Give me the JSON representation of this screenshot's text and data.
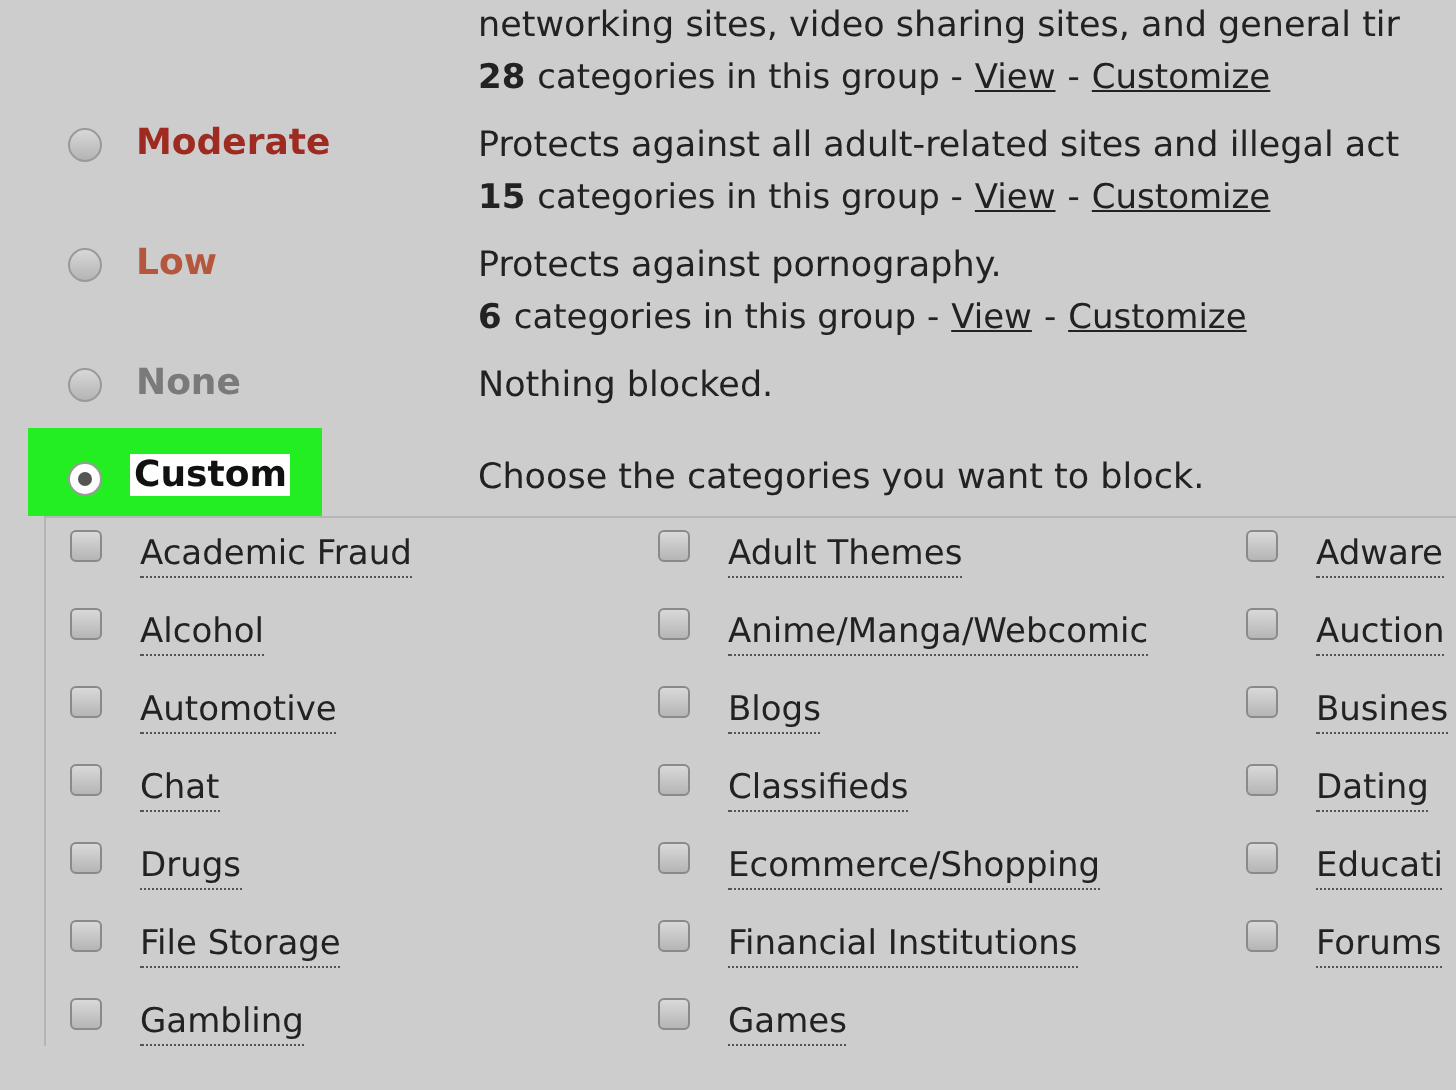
{
  "levels": [
    {
      "description": "networking sites, video sharing sites, and general tir",
      "count": "28",
      "count_text": "categories in this group -",
      "separator": "-",
      "links": [
        "View",
        "Customize"
      ]
    },
    {
      "name": "Moderate",
      "color": "#9e2b22",
      "selected": false,
      "description": "Protects against all adult-related sites and illegal act",
      "count": "15",
      "count_text": "categories in this group -",
      "separator": "-",
      "links": [
        "View",
        "Customize"
      ]
    },
    {
      "name": "Low",
      "color": "#b5573c",
      "selected": false,
      "description": "Protects against pornography.",
      "count": "6",
      "count_text": "categories in this group -",
      "separator": "-",
      "links": [
        "View",
        "Customize"
      ]
    },
    {
      "name": "None",
      "color": "#7a7a7a",
      "selected": false,
      "description": "Nothing blocked."
    },
    {
      "name": "Custom",
      "color": "#111111",
      "selected": true,
      "highlighted": true,
      "description": "Choose the categories you want to block."
    }
  ],
  "categories": [
    {
      "label": "Academic Fraud",
      "checked": false
    },
    {
      "label": "Adult Themes",
      "checked": false
    },
    {
      "label": "Adware",
      "checked": false
    },
    {
      "label": "Alcohol",
      "checked": false
    },
    {
      "label": "Anime/Manga/Webcomic",
      "checked": false
    },
    {
      "label": "Auction",
      "checked": false
    },
    {
      "label": "Automotive",
      "checked": false
    },
    {
      "label": "Blogs",
      "checked": false
    },
    {
      "label": "Busines",
      "checked": false
    },
    {
      "label": "Chat",
      "checked": false
    },
    {
      "label": "Classifieds",
      "checked": false
    },
    {
      "label": "Dating",
      "checked": false
    },
    {
      "label": "Drugs",
      "checked": false
    },
    {
      "label": "Ecommerce/Shopping",
      "checked": false
    },
    {
      "label": "Educati",
      "checked": false
    },
    {
      "label": "File Storage",
      "checked": false
    },
    {
      "label": "Financial Institutions",
      "checked": false
    },
    {
      "label": "Forums",
      "checked": false
    },
    {
      "label": "Gambling",
      "checked": false
    },
    {
      "label": "Games",
      "checked": false
    }
  ]
}
